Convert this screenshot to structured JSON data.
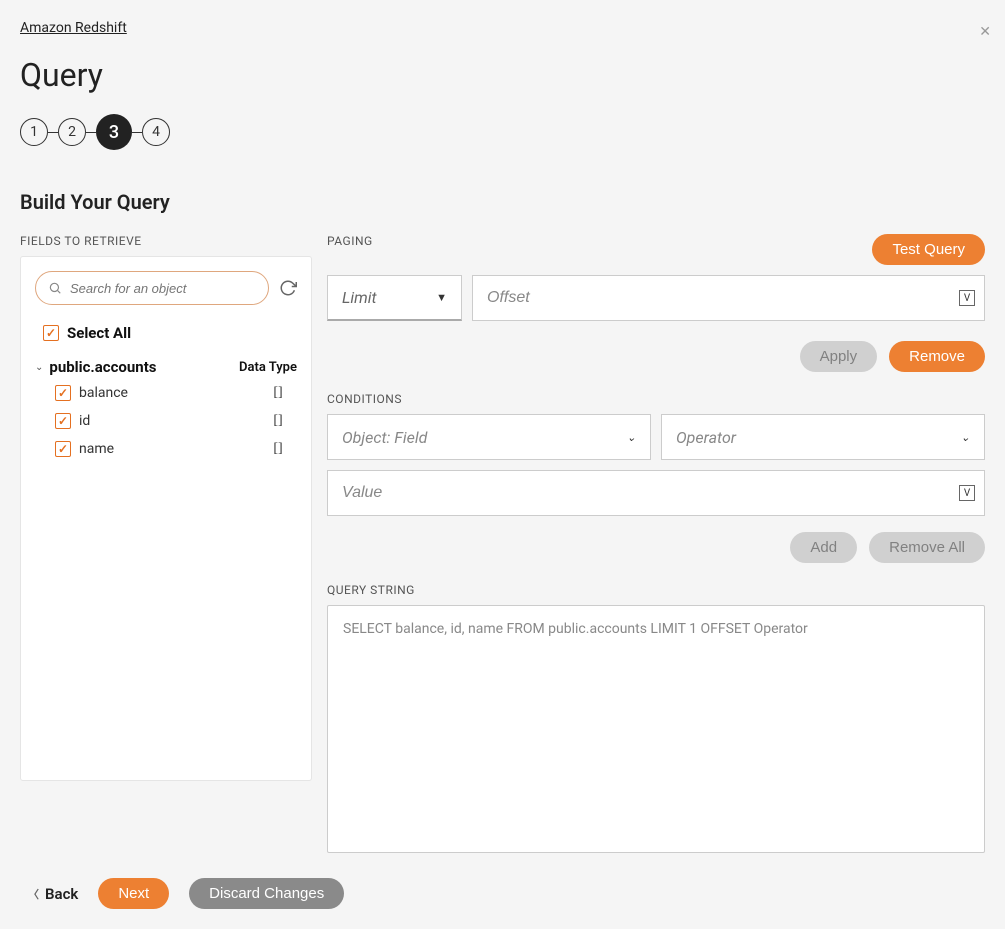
{
  "breadcrumb": "Amazon Redshift",
  "page_title": "Query",
  "stepper": {
    "steps": [
      "1",
      "2",
      "3",
      "4"
    ],
    "active_index": 2
  },
  "section_title": "Build Your Query",
  "fields_label": "FIELDS TO RETRIEVE",
  "search": {
    "placeholder": "Search for an object"
  },
  "select_all_label": "Select All",
  "table": {
    "name": "public.accounts",
    "datatype_header": "Data Type",
    "fields": [
      {
        "name": "balance",
        "type": "[]"
      },
      {
        "name": "id",
        "type": "[]"
      },
      {
        "name": "name",
        "type": "[]"
      }
    ]
  },
  "paging": {
    "label": "PAGING",
    "limit_placeholder": "Limit",
    "offset_placeholder": "Offset"
  },
  "buttons": {
    "test_query": "Test Query",
    "apply": "Apply",
    "remove": "Remove",
    "add": "Add",
    "remove_all": "Remove All",
    "back": "Back",
    "next": "Next",
    "discard": "Discard Changes"
  },
  "conditions": {
    "label": "CONDITIONS",
    "object_field_placeholder": "Object: Field",
    "operator_placeholder": "Operator",
    "value_placeholder": "Value"
  },
  "query_string": {
    "label": "QUERY STRING",
    "value": "SELECT balance, id, name FROM public.accounts  LIMIT 1  OFFSET Operator"
  }
}
